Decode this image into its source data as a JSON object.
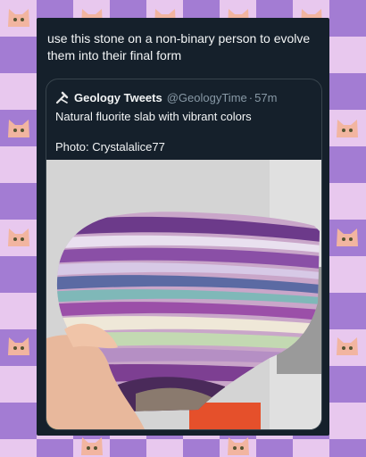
{
  "post": {
    "text": "use this stone on a non-binary person to evolve them into their final form"
  },
  "quote": {
    "account_name": "Geology Tweets",
    "handle": "@GeologyTime",
    "separator": "·",
    "time": "57m",
    "line1": "Natural fluorite slab with vibrant colors",
    "line2": "Photo: Crystalalice77"
  },
  "icons": {
    "account": "hammer-pick-icon"
  },
  "colors": {
    "card_bg": "#15202b",
    "checker_dark": "#a37cd3",
    "checker_light": "#e8c8ee"
  }
}
